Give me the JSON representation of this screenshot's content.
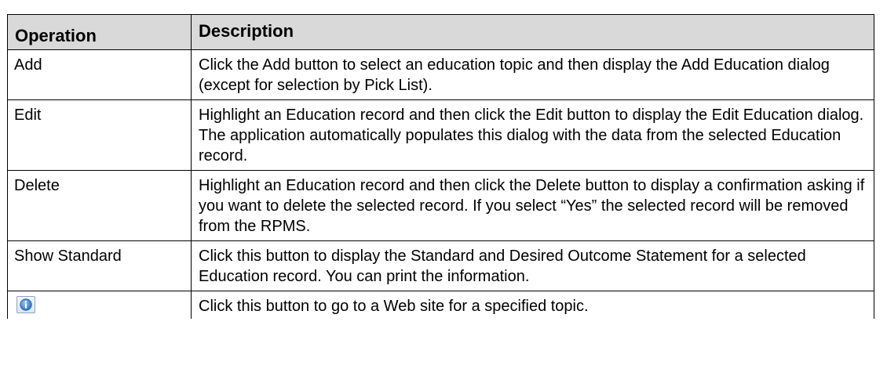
{
  "table": {
    "headers": {
      "operation": "Operation",
      "description": "Description"
    },
    "rows": [
      {
        "operation": "Add",
        "description": "Click the Add button to select an education topic and then display the Add Education dialog (except for selection by Pick List)."
      },
      {
        "operation": "Edit",
        "description": "Highlight an Education record and then click the Edit button to display the Edit Education dialog. The application automatically populates this dialog with the data from the selected Education record."
      },
      {
        "operation": "Delete",
        "description": "Highlight an Education record and then click the Delete button to display a confirmation asking if you want to delete the selected record. If you select “Yes” the selected record will be removed from the RPMS."
      },
      {
        "operation": "Show Standard",
        "description": "Click this button to display the Standard and Desired Outcome Statement for a selected Education record. You can print the information."
      },
      {
        "operation_icon": "info-icon",
        "description": "Click this button to go to a Web site for a specified topic."
      }
    ]
  },
  "colors": {
    "header_background": "#d9d9d9",
    "border": "#000000",
    "info_icon": "#2f6fc0"
  }
}
